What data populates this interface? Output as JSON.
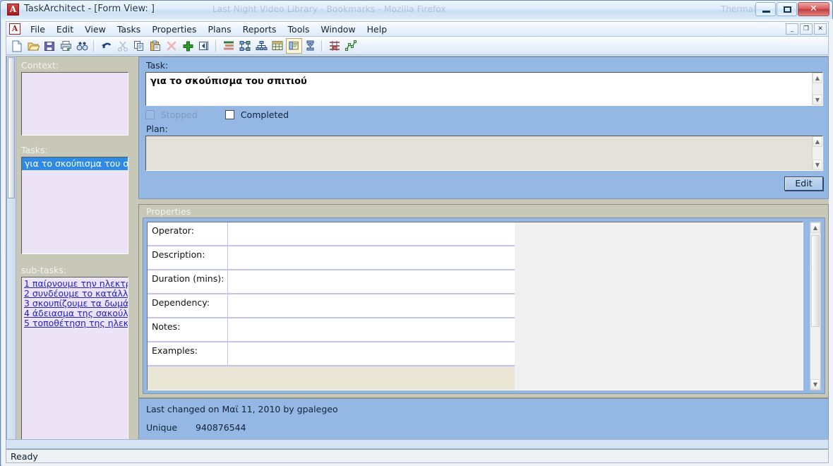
{
  "window": {
    "title": "TaskArchitect - [Form View: ]",
    "app_icon": "A",
    "ghost_text": "Last Night Video Library - Bookmarks - Mozilla Firefox",
    "ghost_text_right": "Thermal",
    "buttons": {
      "minimize": "minimize-icon",
      "maximize": "maximize-icon",
      "close": "✕"
    }
  },
  "menubar": {
    "app_icon": "A",
    "items": [
      {
        "label": "File",
        "accel": "F"
      },
      {
        "label": "Edit",
        "accel": "E"
      },
      {
        "label": "View",
        "accel": "V"
      },
      {
        "label": "Tasks",
        "accel": "T"
      },
      {
        "label": "Properties",
        "accel": "P"
      },
      {
        "label": "Plans",
        "accel": ""
      },
      {
        "label": "Reports",
        "accel": "R"
      },
      {
        "label": "Tools",
        "accel": "T"
      },
      {
        "label": "Window",
        "accel": "W"
      },
      {
        "label": "Help",
        "accel": "H"
      }
    ],
    "mdi_buttons": [
      "_",
      "❐",
      "✕"
    ]
  },
  "toolbar": {
    "items": [
      {
        "name": "new-document-icon",
        "title": "New"
      },
      {
        "name": "open-folder-icon",
        "title": "Open"
      },
      {
        "name": "save-disk-icon",
        "title": "Save"
      },
      {
        "name": "print-icon",
        "title": "Print"
      },
      {
        "name": "find-binoculars-icon",
        "title": "Find"
      },
      {
        "name": "separator",
        "title": ""
      },
      {
        "name": "undo-arrow-icon",
        "title": "Undo"
      },
      {
        "name": "cut-scissors-icon",
        "title": "Cut"
      },
      {
        "name": "copy-icon",
        "title": "Copy"
      },
      {
        "name": "paste-clipboard-icon",
        "title": "Paste"
      },
      {
        "name": "delete-x-icon",
        "title": "Delete"
      },
      {
        "name": "add-plus-icon",
        "title": "Add"
      },
      {
        "name": "promote-task-icon",
        "title": "Promote"
      },
      {
        "name": "separator",
        "title": ""
      },
      {
        "name": "outline-view-icon",
        "title": "Outline View"
      },
      {
        "name": "network-view-icon",
        "title": "Network View"
      },
      {
        "name": "hierarchy-view-icon",
        "title": "Hierarchy View"
      },
      {
        "name": "table-view-icon",
        "title": "Table View"
      },
      {
        "name": "form-view-icon",
        "title": "Form View"
      },
      {
        "name": "flow-view-icon",
        "title": "Flow View"
      },
      {
        "name": "separator",
        "title": ""
      },
      {
        "name": "gantt-view-icon",
        "title": "Gantt View"
      },
      {
        "name": "chart-view-icon",
        "title": "Chart View"
      }
    ]
  },
  "sidebar": {
    "context": {
      "label": "Context:",
      "items": []
    },
    "tasks": {
      "label": "Tasks:",
      "items": [
        "για το σκούπισμα του σ"
      ],
      "selected_index": 0
    },
    "subtasks": {
      "label": "sub-tasks:",
      "items": [
        "1 παίρνουμε την ηλεκτρ",
        "2 συνδέουμε το κατάλλ",
        "3 σκουπίζουμε τα δωμά",
        "4 άδειασμα της σακούλ",
        "5 τοποθέτηση της ηλεκ"
      ]
    }
  },
  "form": {
    "task_label": "Task:",
    "task_value": "για το σκούπισμα του σπιτιού",
    "stopped_label": "Stopped",
    "stopped_checked": false,
    "stopped_disabled": true,
    "completed_label": "Completed",
    "completed_checked": false,
    "plan_label": "Plan:",
    "plan_value": "",
    "edit_button": "Edit"
  },
  "properties": {
    "title": "Properties",
    "rows": [
      {
        "key": "Operator:",
        "value": ""
      },
      {
        "key": "Description:",
        "value": ""
      },
      {
        "key": "Duration (mins):",
        "value": ""
      },
      {
        "key": "Dependency:",
        "value": ""
      },
      {
        "key": "Notes:",
        "value": ""
      },
      {
        "key": "Examples:",
        "value": ""
      }
    ]
  },
  "footer": {
    "last_changed": "Last changed on Μαϊ 11, 2010 by gpalegeo",
    "unique_label": "Unique",
    "unique_value": "940876544"
  },
  "statusbar": {
    "text": "Ready"
  },
  "colors": {
    "form_blue": "#95b7e4",
    "panel_tan": "#c8c8b8",
    "listbox_lavender": "#ece3f7",
    "selection_blue": "#2d8ae5",
    "link_blue": "#2222cc",
    "prop_blank": "#e9e6d6"
  }
}
